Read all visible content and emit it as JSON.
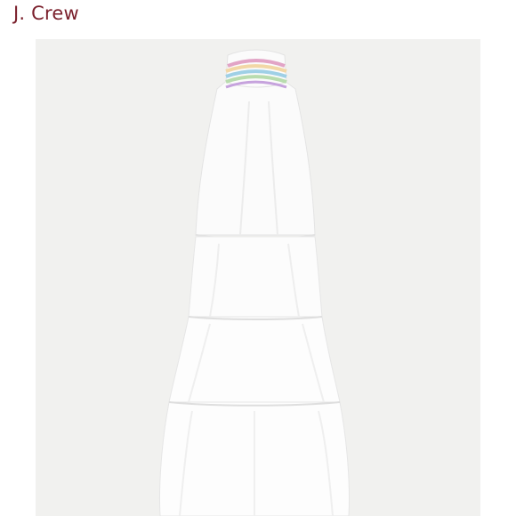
{
  "header": {
    "brand": "J. Crew"
  },
  "photo": {
    "product_icon": "white-tiered-halter-maxi-dress",
    "colors": {
      "background": "#f1f1ef",
      "dress": "#fbfbfb",
      "shadow": "#e4e4e4",
      "embroidery": [
        "#e2a4c6",
        "#f2d7a6",
        "#9fd0e6",
        "#b8dcae",
        "#c6a3dd"
      ]
    }
  }
}
